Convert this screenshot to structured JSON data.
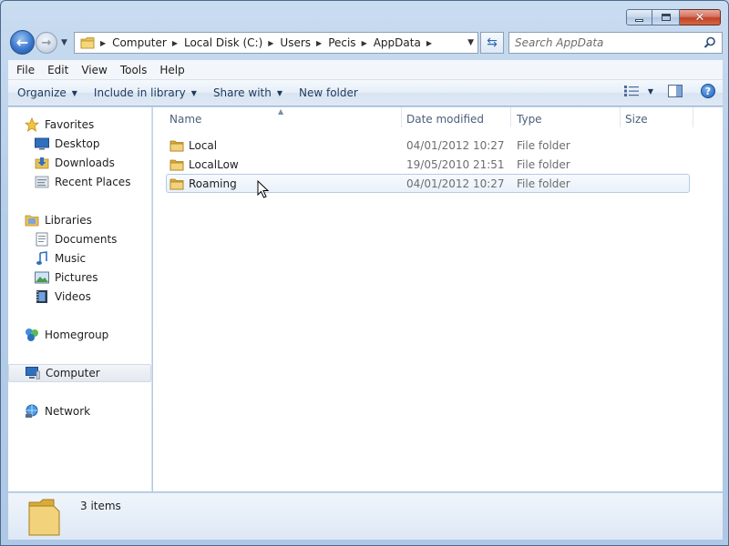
{
  "window": {
    "caption": {
      "minimize_icon": "minimize-icon",
      "maximize_icon": "maximize-icon",
      "close_icon": "close-icon"
    }
  },
  "nav": {
    "back_icon": "back-arrow-icon",
    "forward_icon": "forward-arrow-icon",
    "breadcrumb": [
      "Computer",
      "Local Disk (C:)",
      "Users",
      "Pecis",
      "AppData"
    ],
    "refresh_icon": "refresh-icon",
    "search_placeholder": "Search AppData"
  },
  "menu": [
    "File",
    "Edit",
    "View",
    "Tools",
    "Help"
  ],
  "commands": {
    "organize": "Organize",
    "include": "Include in library",
    "share": "Share with",
    "new_folder": "New folder"
  },
  "navpane": {
    "favorites": {
      "label": "Favorites",
      "items": [
        "Desktop",
        "Downloads",
        "Recent Places"
      ]
    },
    "libraries": {
      "label": "Libraries",
      "items": [
        "Documents",
        "Music",
        "Pictures",
        "Videos"
      ]
    },
    "homegroup": "Homegroup",
    "computer": "Computer",
    "network": "Network"
  },
  "columns": {
    "name": "Name",
    "date": "Date modified",
    "type": "Type",
    "size": "Size"
  },
  "files": [
    {
      "name": "Local",
      "date": "04/01/2012 10:27",
      "type": "File folder",
      "size": ""
    },
    {
      "name": "LocalLow",
      "date": "19/05/2010 21:51",
      "type": "File folder",
      "size": ""
    },
    {
      "name": "Roaming",
      "date": "04/01/2012 10:27",
      "type": "File folder",
      "size": ""
    }
  ],
  "status": {
    "count": "3 items"
  },
  "colors": {
    "folder": "#e8c158",
    "selection_border": "#b6cbe4",
    "window_frame": "#bcd3ea",
    "close_button": "#c0412a"
  }
}
